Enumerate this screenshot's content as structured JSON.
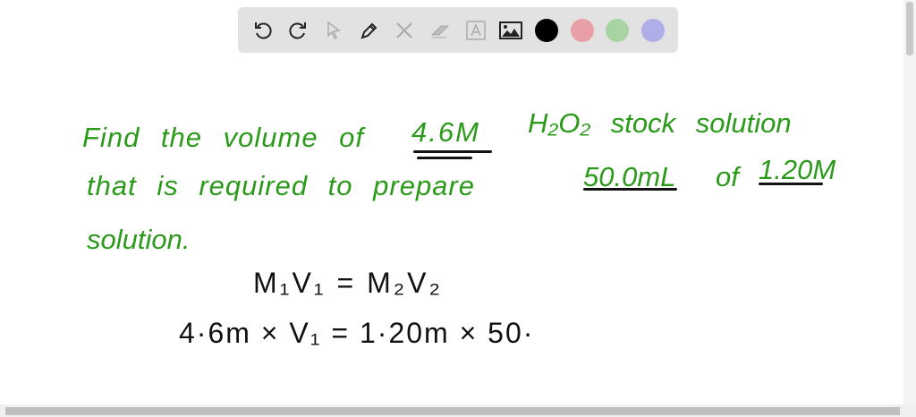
{
  "toolbar": {
    "tools": [
      "undo-icon",
      "redo-icon",
      "select-icon",
      "pen-icon",
      "tools-icon",
      "eraser-icon",
      "text-icon",
      "image-icon"
    ],
    "colors": [
      "#000000",
      "#e8a0a6",
      "#a8d4a4",
      "#b0aee8"
    ]
  },
  "board": {
    "line1": [
      "Find the volume of",
      "4.6M",
      "H₂O₂ stock solution"
    ],
    "line2": [
      "that is required to prepare",
      "50.0mL",
      "of",
      "1.20M"
    ],
    "line3": "solution.",
    "eq1": "M₁V₁ = M₂V₂",
    "eq2": "4·6m × V₁ = 1·20m × 50·",
    "ink_color": "#2b9a1a"
  }
}
